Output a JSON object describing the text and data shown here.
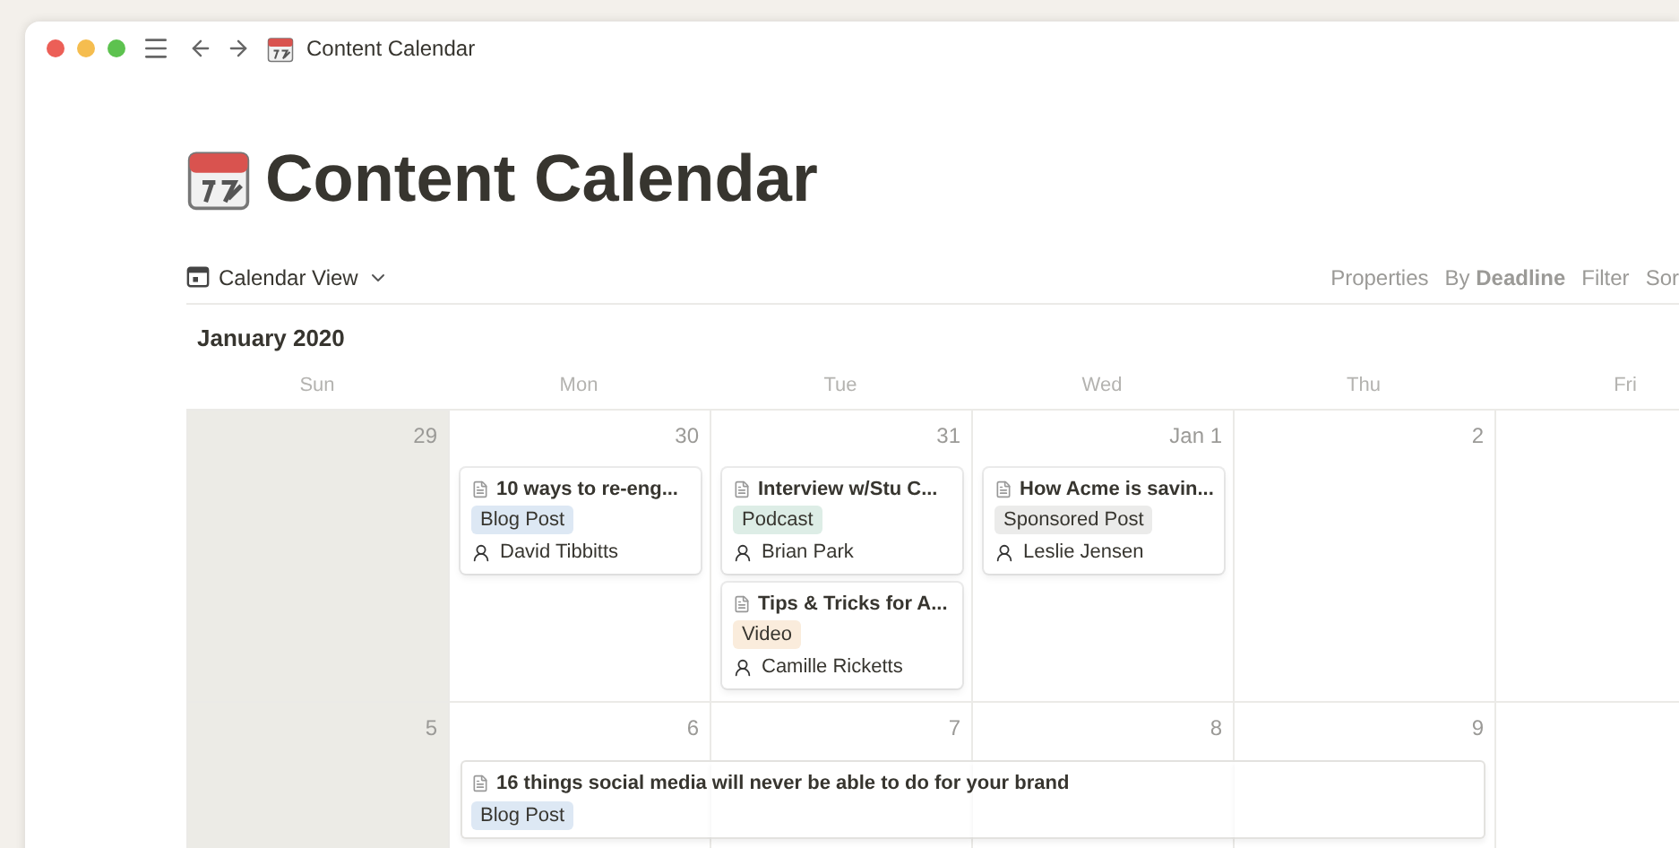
{
  "window": {
    "breadcrumb": "Content Calendar"
  },
  "page": {
    "title": "Content Calendar"
  },
  "toolbar": {
    "view": "Calendar View",
    "actions": [
      {
        "kind": "plain",
        "label": "Properties"
      },
      {
        "kind": "rich",
        "label": "By **Deadline**"
      },
      {
        "kind": "plain",
        "label": "Filter"
      },
      {
        "kind": "plain",
        "label": "Sor"
      }
    ]
  },
  "calendar": {
    "month": "January 2020",
    "weekdays": [
      "Sun",
      "Mon",
      "Tue",
      "Wed",
      "Thu",
      "Fri"
    ],
    "weeks": [
      {
        "days": [
          {
            "date": "29",
            "weekend": true
          },
          {
            "date": "30",
            "weekend": false,
            "events": [
              {
                "title": "10 ways to re-eng...",
                "tag": {
                  "label": "Blog Post",
                  "color": "#dde8f4"
                },
                "person": "David Tibbitts"
              }
            ]
          },
          {
            "date": "31",
            "weekend": false,
            "events": [
              {
                "title": "Interview w/Stu C...",
                "tag": {
                  "label": "Podcast",
                  "color": "#ddede6"
                },
                "person": "Brian Park"
              },
              {
                "title": "Tips & Tricks for A...",
                "tag": {
                  "label": "Video",
                  "color": "#faecdc"
                },
                "person": "Camille Ricketts"
              }
            ]
          },
          {
            "date": "Jan 1",
            "weekend": false,
            "events": [
              {
                "title": "How Acme is savin...",
                "tag": {
                  "label": "Sponsored Post",
                  "color": "#ebebea"
                },
                "person": "Leslie Jensen"
              }
            ]
          },
          {
            "date": "2",
            "weekend": false
          },
          {
            "weekend": false
          }
        ]
      },
      {
        "banner": {
          "title": "16 things social media will never be able to do for your brand",
          "tag": {
            "label": "Blog Post",
            "color": "#dde8f4"
          }
        },
        "days": [
          {
            "date": "5",
            "weekend": true,
            "banner": false
          },
          {
            "date": "6",
            "weekend": false,
            "banner": true
          },
          {
            "date": "7",
            "weekend": false,
            "banner": true
          },
          {
            "date": "8",
            "weekend": false,
            "banner": true
          },
          {
            "date": "9",
            "weekend": false,
            "banner": true
          },
          {
            "weekend": false,
            "banner": false
          }
        ]
      }
    ]
  }
}
